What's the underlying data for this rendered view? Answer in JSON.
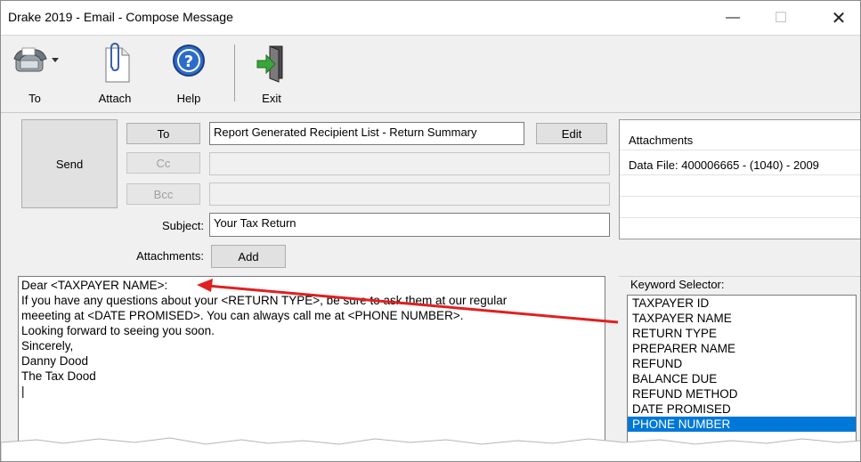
{
  "window": {
    "title": "Drake 2019 - Email - Compose Message",
    "min_glyph": "—",
    "max_glyph": "☐",
    "close_glyph": "✕"
  },
  "toolbar": {
    "to_label": "To",
    "to_icon": "fax-phone-icon",
    "attach_label": "Attach",
    "attach_icon": "paperclip-page-icon",
    "help_label": "Help",
    "help_icon": "question-circle-icon",
    "exit_label": "Exit",
    "exit_icon": "exit-door-icon"
  },
  "compose": {
    "send_label": "Send",
    "to_button": "To",
    "cc_button": "Cc",
    "bcc_button": "Bcc",
    "to_value": "Report Generated Recipient List - Return Summary",
    "edit_button": "Edit",
    "cc_value": "",
    "bcc_value": "",
    "subject_label": "Subject:",
    "subject_value": "Your Tax Return",
    "attachments_label": "Attachments:",
    "add_button": "Add"
  },
  "attachments_panel": {
    "header": "Attachments",
    "items": [
      "Data File: 400006665 - (1040) - 2009"
    ]
  },
  "message_body": {
    "lines": [
      "Dear <TAXPAYER NAME>:",
      "If you have any questions about your <RETURN TYPE>, be sure to ask them at our regular",
      "meeeting at <DATE PROMISED>. You can always call me at <PHONE NUMBER>.",
      "",
      "Looking forward to seeing you soon.",
      "",
      "Sincerely,",
      "",
      "Danny Dood",
      "The Tax Dood",
      "|"
    ]
  },
  "keyword_selector": {
    "title": "Keyword Selector:",
    "items": [
      "TAXPAYER ID",
      "TAXPAYER NAME",
      "RETURN TYPE",
      "PREPARER NAME",
      "REFUND",
      "BALANCE DUE",
      "REFUND METHOD",
      "DATE PROMISED",
      "PHONE NUMBER"
    ],
    "selected": "PHONE NUMBER"
  },
  "colors": {
    "selection": "#0078d7",
    "arrow": "#e02020",
    "exit_green": "#3aa53a"
  }
}
